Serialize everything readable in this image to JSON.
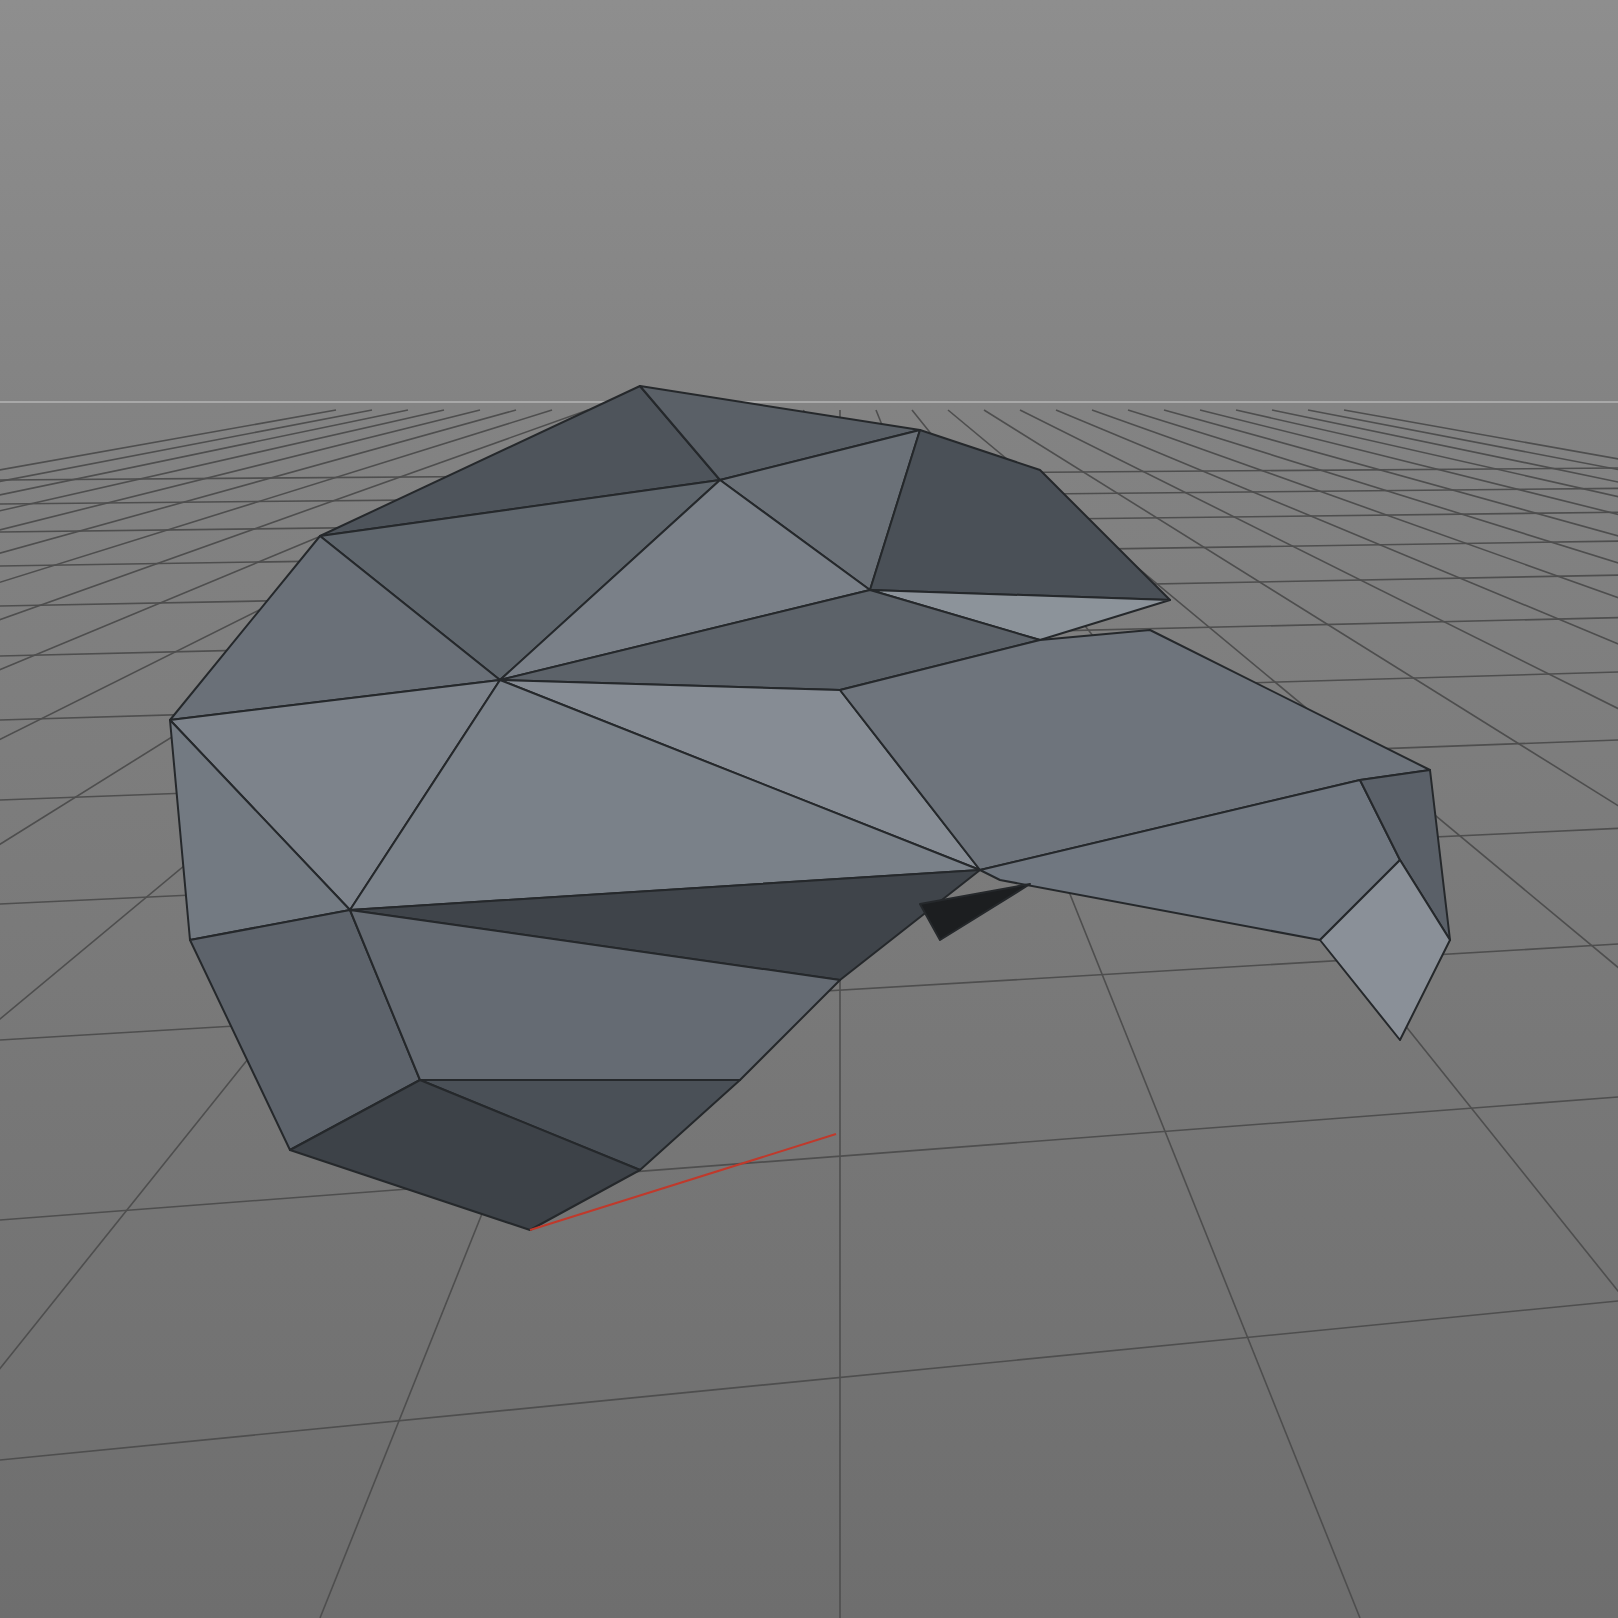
{
  "viewport": {
    "show_grid": true,
    "show_axis": true
  }
}
